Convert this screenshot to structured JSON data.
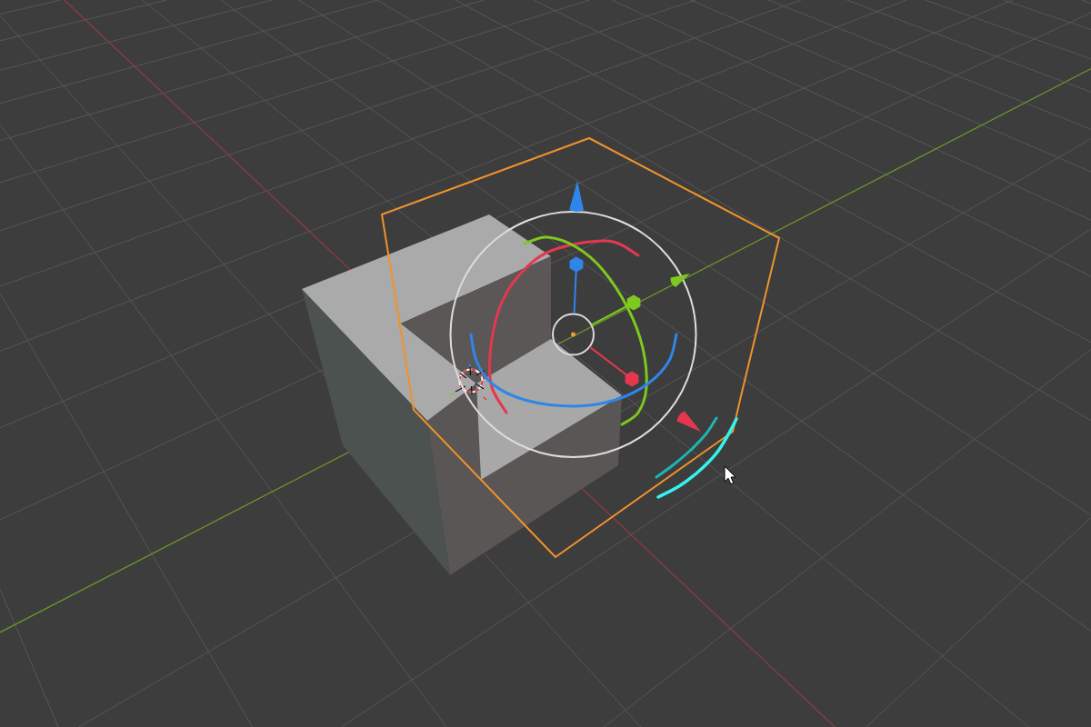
{
  "viewport": {
    "grid": {
      "axes": [
        {
          "kind": "x",
          "color": "#8e3a44"
        },
        {
          "kind": "y",
          "color": "#6a942b"
        }
      ]
    },
    "objects": [
      {
        "kind": "solid",
        "selected": false
      },
      {
        "kind": "bounds",
        "selected": true
      }
    ],
    "gizmo": {
      "axes": [
        {
          "kind": "x",
          "color": "#e5384f"
        },
        {
          "kind": "y",
          "color": "#7fc81f"
        },
        {
          "kind": "z",
          "color": "#2f86ea"
        }
      ]
    }
  }
}
